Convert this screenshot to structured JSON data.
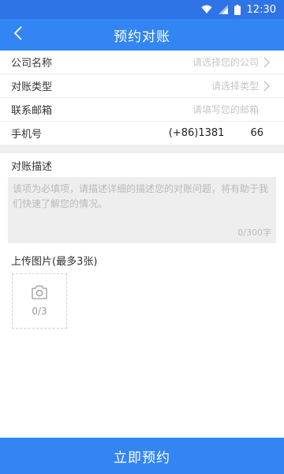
{
  "status_bar": {
    "time": "12:30",
    "icons": [
      "wifi-icon",
      "signal-icon",
      "battery-icon"
    ]
  },
  "header": {
    "title": "预约对账",
    "back_icon": "chevron-left-icon"
  },
  "form": {
    "company": {
      "label": "公司名称",
      "placeholder": "请选择您的公司"
    },
    "type": {
      "label": "对账类型",
      "placeholder": "请选择类型"
    },
    "email": {
      "label": "联系邮箱",
      "placeholder": "请填写您的邮箱"
    },
    "phone": {
      "label": "手机号",
      "value": "(+86)1381        66"
    }
  },
  "description": {
    "title": "对账描述",
    "placeholder": "该项为必填项，请描述详细的描述您的对账问题，将有助于我们快速了解您的情况。",
    "counter": "0/300字"
  },
  "upload": {
    "title": "上传图片(最多3张)",
    "count": "0/3",
    "icon": "camera-icon"
  },
  "submit_label": "立即预约",
  "colors": {
    "primary": "#3385f4",
    "status_bar": "#2f74e6",
    "placeholder": "#c6c6c6",
    "section_bg": "#efefef"
  }
}
